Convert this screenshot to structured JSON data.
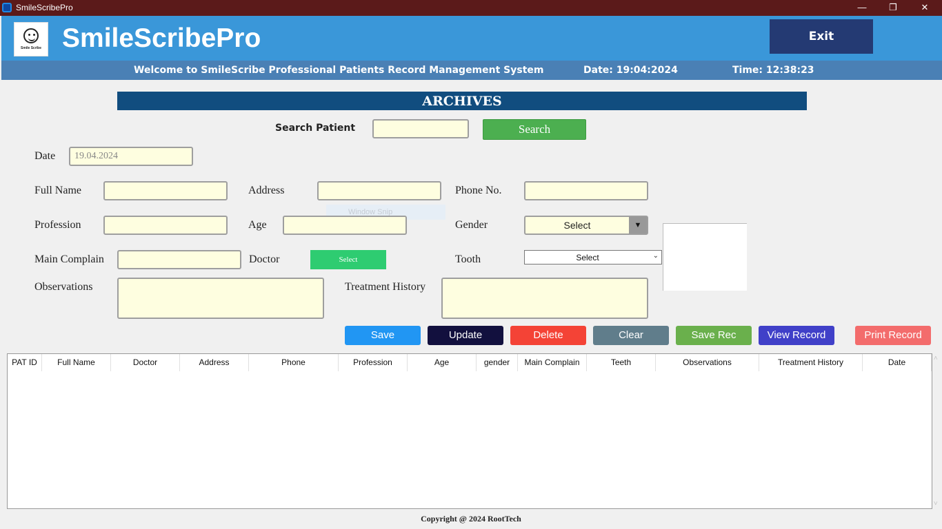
{
  "window": {
    "title": "SmileScribePro",
    "minimize": "—",
    "restore": "❐",
    "close": "✕"
  },
  "header": {
    "logo_text": "Smile Scribe",
    "app_title": "SmileScribePro",
    "exit_label": "Exit"
  },
  "infobar": {
    "welcome": "Welcome to SmileScribe Professional Patients Record Management System",
    "date": "Date: 19:04:2024",
    "time": "Time: 12:38:23"
  },
  "section_title": "ARCHIVES",
  "search": {
    "label": "Search Patient",
    "value": "",
    "button": "Search"
  },
  "form": {
    "date_label": "Date",
    "date_value": "19.04.2024",
    "full_name_label": "Full Name",
    "address_label": "Address",
    "phone_label": "Phone No.",
    "profession_label": "Profession",
    "age_label": "Age",
    "gender_label": "Gender",
    "gender_value": "Select",
    "main_complain_label": "Main Complain",
    "doctor_label": "Doctor",
    "doctor_value": "Select",
    "tooth_label": "Tooth",
    "tooth_value": "Select",
    "observations_label": "Observations",
    "treatment_history_label": "Treatment History"
  },
  "overlay": {
    "snip_text": "Window Snip"
  },
  "actions": [
    {
      "label": "Save",
      "color": "#2196f3"
    },
    {
      "label": "Update",
      "color": "#12103e"
    },
    {
      "label": "Delete",
      "color": "#f44336"
    },
    {
      "label": "Clear",
      "color": "#607d8b"
    },
    {
      "label": "Save Rec",
      "color": "#6ab04c"
    },
    {
      "label": "View Record",
      "color": "#4040c8"
    },
    {
      "label": "Print Record",
      "color": "#f36c6c"
    }
  ],
  "table": {
    "columns": [
      "PAT ID",
      "Full Name",
      "Doctor",
      "Address",
      "Phone",
      "Profession",
      "Age",
      "gender",
      "Main Complain",
      "Teeth",
      "Observations",
      "Treatment History",
      "Date"
    ],
    "rows": []
  },
  "footer": "Copyright @ 2024 RootTech",
  "colors": {
    "titlebar": "#5b1a1a",
    "header": "#3a97d9",
    "infobar": "#4a80b5",
    "archives_bar": "#114d7f",
    "input_bg": "#fefee0"
  }
}
